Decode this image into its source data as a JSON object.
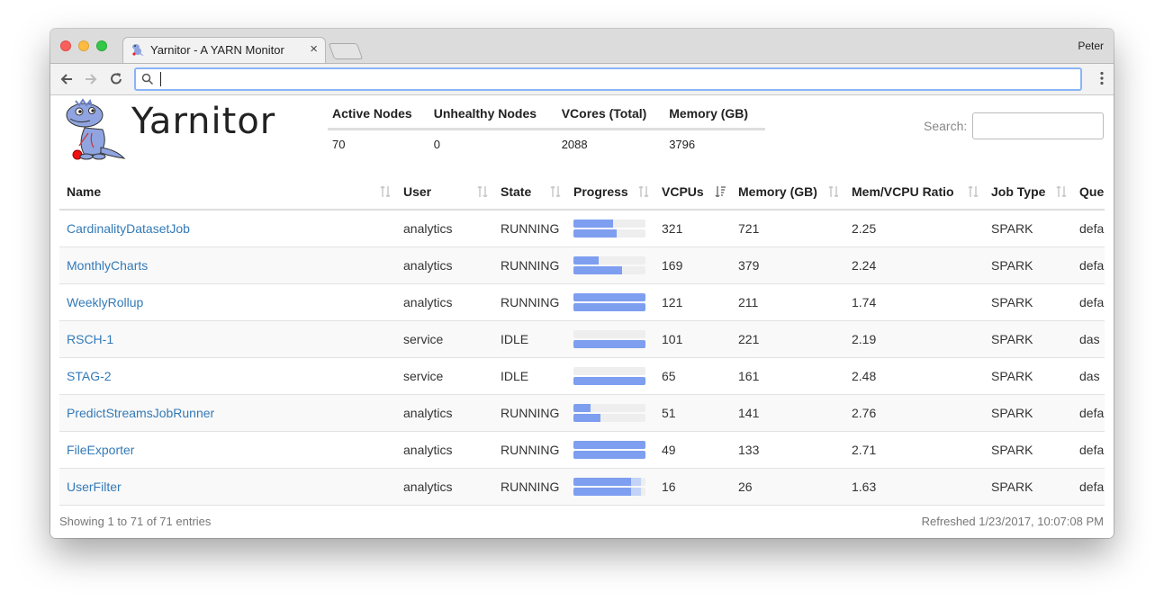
{
  "browser": {
    "tab_title": "Yarnitor - A YARN Monitor",
    "tab_close": "×",
    "profile_name": "Peter",
    "address": ""
  },
  "app": {
    "logo_text": "Yarnitor"
  },
  "cluster": {
    "headers": [
      "Active Nodes",
      "Unhealthy Nodes",
      "VCores (Total)",
      "Memory (GB)"
    ],
    "values": [
      "70",
      "0",
      "2088",
      "3796"
    ]
  },
  "search": {
    "label": "Search:",
    "value": ""
  },
  "table": {
    "columns": [
      "Name",
      "User",
      "State",
      "Progress",
      "VCPUs",
      "Memory (GB)",
      "Mem/VCPU Ratio",
      "Job Type",
      "Que"
    ],
    "rows": [
      {
        "name": "CardinalityDatasetJob",
        "user": "analytics",
        "state": "RUNNING",
        "vcpus": "321",
        "memory": "721",
        "ratio": "2.25",
        "job_type": "SPARK",
        "queue": "defa",
        "progress": [
          0.55,
          0.6
        ],
        "progress_ext": [
          0,
          0
        ]
      },
      {
        "name": "MonthlyCharts",
        "user": "analytics",
        "state": "RUNNING",
        "vcpus": "169",
        "memory": "379",
        "ratio": "2.24",
        "job_type": "SPARK",
        "queue": "defa",
        "progress": [
          0.35,
          0.67
        ],
        "progress_ext": [
          0,
          0
        ]
      },
      {
        "name": "WeeklyRollup",
        "user": "analytics",
        "state": "RUNNING",
        "vcpus": "121",
        "memory": "211",
        "ratio": "1.74",
        "job_type": "SPARK",
        "queue": "defa",
        "progress": [
          1.0,
          1.0
        ],
        "progress_ext": [
          0,
          0
        ]
      },
      {
        "name": "RSCH-1",
        "user": "service",
        "state": "IDLE",
        "vcpus": "101",
        "memory": "221",
        "ratio": "2.19",
        "job_type": "SPARK",
        "queue": "das",
        "progress": [
          0,
          1.0
        ],
        "progress_ext": [
          0,
          0
        ]
      },
      {
        "name": "STAG-2",
        "user": "service",
        "state": "IDLE",
        "vcpus": "65",
        "memory": "161",
        "ratio": "2.48",
        "job_type": "SPARK",
        "queue": "das",
        "progress": [
          0,
          1.0
        ],
        "progress_ext": [
          0,
          0
        ]
      },
      {
        "name": "PredictStreamsJobRunner",
        "user": "analytics",
        "state": "RUNNING",
        "vcpus": "51",
        "memory": "141",
        "ratio": "2.76",
        "job_type": "SPARK",
        "queue": "defa",
        "progress": [
          0.24,
          0.37
        ],
        "progress_ext": [
          0,
          0
        ]
      },
      {
        "name": "FileExporter",
        "user": "analytics",
        "state": "RUNNING",
        "vcpus": "49",
        "memory": "133",
        "ratio": "2.71",
        "job_type": "SPARK",
        "queue": "defa",
        "progress": [
          1.0,
          1.0
        ],
        "progress_ext": [
          0,
          0
        ]
      },
      {
        "name": "UserFilter",
        "user": "analytics",
        "state": "RUNNING",
        "vcpus": "16",
        "memory": "26",
        "ratio": "1.63",
        "job_type": "SPARK",
        "queue": "defa",
        "progress": [
          0.8,
          0.8
        ],
        "progress_ext": [
          0.14,
          0.14
        ]
      }
    ],
    "sorted_column": "VCPUs"
  },
  "footer": {
    "entries_text": "Showing 1 to 71 of 71 entries",
    "refreshed_text": "Refreshed 1/23/2017, 10:07:08 PM"
  },
  "colors": {
    "link": "#337ab7",
    "progress_fill": "#7e9ef0",
    "progress_ext": "#c3d3f7",
    "progress_track": "#eeeeee"
  }
}
